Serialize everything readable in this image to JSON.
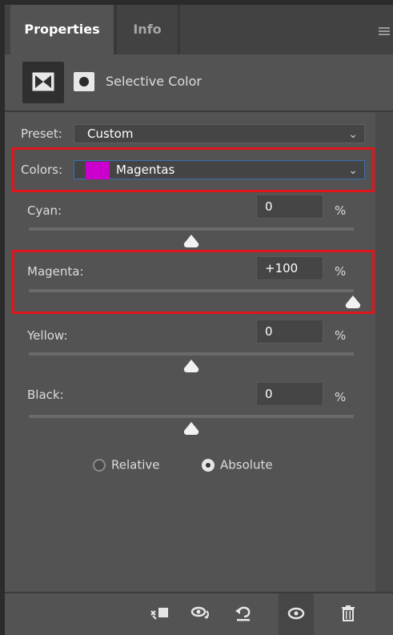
{
  "tabs": [
    {
      "label": "Properties",
      "active": true
    },
    {
      "label": "Info",
      "active": false
    }
  ],
  "header": {
    "title": "Selective Color",
    "icons": [
      "adjustment-layer-icon",
      "mask-icon"
    ]
  },
  "preset": {
    "label": "Preset:",
    "value": "Custom"
  },
  "colors": {
    "label": "Colors:",
    "value": "Magentas",
    "swatch_color": "#cc00cc"
  },
  "sliders": [
    {
      "label": "Cyan:",
      "value": "0",
      "unit": "%",
      "position_fraction": 0.5
    },
    {
      "label": "Magenta:",
      "value": "+100",
      "unit": "%",
      "position_fraction": 1.0
    },
    {
      "label": "Yellow:",
      "value": "0",
      "unit": "%",
      "position_fraction": 0.5
    },
    {
      "label": "Black:",
      "value": "0",
      "unit": "%",
      "position_fraction": 0.5
    }
  ],
  "method": {
    "options": [
      {
        "label": "Relative",
        "selected": false
      },
      {
        "label": "Absolute",
        "selected": true
      }
    ]
  },
  "toolbar": {
    "icons": [
      "clip-to-layer-icon",
      "view-previous-state-icon",
      "reset-icon",
      "visibility-eye-icon",
      "trash-icon"
    ]
  },
  "colors_theme": {
    "panel_bg": "#535353",
    "highlight_red": "#e0161c",
    "field_bg": "#454545"
  }
}
